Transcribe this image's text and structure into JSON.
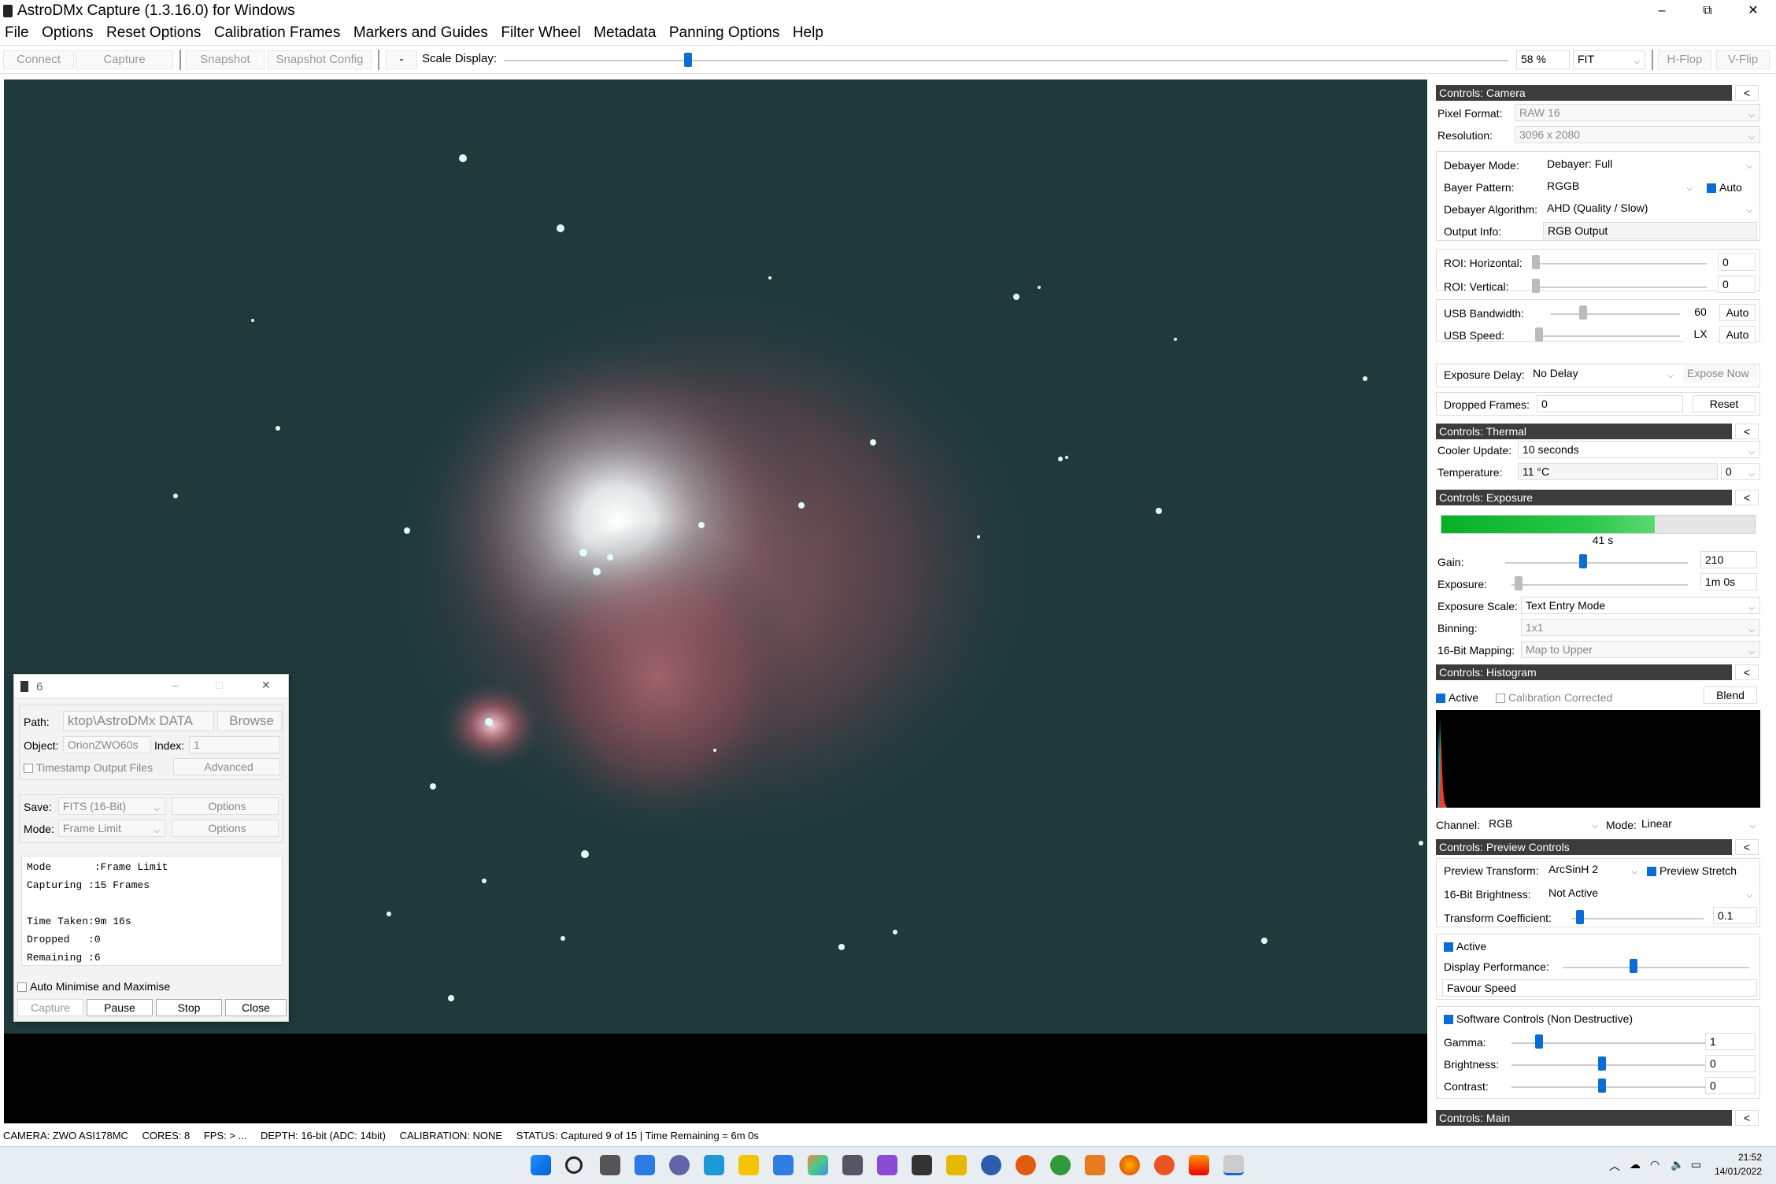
{
  "window": {
    "title": "AstroDMx Capture (1.3.16.0) for Windows",
    "minimize": "–",
    "restore": "⧉",
    "close": "✕"
  },
  "menu": [
    "File",
    "Options",
    "Reset Options",
    "Calibration Frames",
    "Markers and Guides",
    "Filter Wheel",
    "Metadata",
    "Panning Options",
    "Help"
  ],
  "toolbar": {
    "connect": "Connect",
    "capture": "Capture",
    "snapshot": "Snapshot",
    "snapshot_config": "Snapshot Config",
    "minus": "-",
    "scale_label": "Scale Display:",
    "scale_value": "58 %",
    "scale_percent": 58,
    "fit": "FIT",
    "hflip": "H-Flop",
    "vflip": "V-Flip"
  },
  "camera": {
    "header": "Controls: Camera",
    "collapse": "<",
    "pixel_format_label": "Pixel Format:",
    "pixel_format": "RAW 16",
    "resolution_label": "Resolution:",
    "resolution": "3096 x 2080",
    "debayer_mode_label": "Debayer Mode:",
    "debayer_mode": "Debayer: Full",
    "bayer_label": "Bayer Pattern:",
    "bayer": "RGGB",
    "auto": "Auto",
    "algo_label": "Debayer Algorithm:",
    "algo": "AHD (Quality / Slow)",
    "output_label": "Output Info:",
    "output": "RGB Output",
    "roi_h_label": "ROI: Horizontal:",
    "roi_h": "0",
    "roi_v_label": "ROI: Vertical:",
    "roi_v": "0",
    "usb_bw_label": "USB Bandwidth:",
    "usb_bw": "60",
    "usb_speed_label": "USB Speed:",
    "usb_speed": "LX",
    "exp_delay_label": "Exposure Delay:",
    "exp_delay": "No Delay",
    "expose_now": "Expose Now",
    "dropped_label": "Dropped Frames:",
    "dropped": "0",
    "reset": "Reset"
  },
  "thermal": {
    "header": "Controls: Thermal",
    "collapse": "<",
    "cooler_label": "Cooler Update:",
    "cooler": "10 seconds",
    "temp_label": "Temperature:",
    "temp": "11 °C",
    "temp_set": "0"
  },
  "exposure": {
    "header": "Controls: Exposure",
    "collapse": "<",
    "progress_text": "41 s",
    "progress_fraction": 0.68,
    "gain_label": "Gain:",
    "gain": "210",
    "exposure_label": "Exposure:",
    "exposure": "1m 0s",
    "scale_label": "Exposure Scale:",
    "scale": "Text Entry Mode",
    "binning_label": "Binning:",
    "binning": "1x1",
    "mapping_label": "16-Bit Mapping:",
    "mapping": "Map to Upper"
  },
  "histogram": {
    "header": "Controls: Histogram",
    "collapse": "<",
    "active": "Active",
    "calib": "Calibration Corrected",
    "blend": "Blend",
    "channel_label": "Channel:",
    "channel": "RGB",
    "mode_label": "Mode:",
    "mode": "Linear"
  },
  "preview": {
    "header": "Controls: Preview Controls",
    "collapse": "<",
    "transform_label": "Preview Transform:",
    "transform": "ArcSinH 2",
    "stretch": "Preview Stretch",
    "brightness16_label": "16-Bit Brightness:",
    "brightness16": "Not Active",
    "coef_label": "Transform Coefficient:",
    "coef": "0.1",
    "active": "Active",
    "perf_label": "Display Performance:",
    "perf": "Favour Speed",
    "software": "Software Controls (Non Destructive)",
    "gamma_label": "Gamma:",
    "gamma": "1",
    "bright_label": "Brightness:",
    "bright": "0",
    "contrast_label": "Contrast:",
    "contrast": "0"
  },
  "main": {
    "header": "Controls: Main",
    "collapse": "<"
  },
  "status": {
    "camera": "CAMERA: ZWO ASI178MC",
    "cores": "CORES: 8",
    "fps": "FPS: > ...",
    "depth": "DEPTH: 16-bit (ADC: 14bit)",
    "calibration": "CALIBRATION: NONE",
    "status": "STATUS: Captured 9 of 15 | Time Remaining = 6m 0s"
  },
  "capture_window": {
    "title": "6",
    "path_label": "Path:",
    "path": "ktop\\AstroDMx DATA",
    "browse": "Browse",
    "object_label": "Object:",
    "object": "OrionZWO60s",
    "index_label": "Index:",
    "index": "1",
    "timestamp": "Timestamp Output Files",
    "advanced": "Advanced",
    "save_label": "Save:",
    "save": "FITS (16-Bit)",
    "options": "Options",
    "mode_label": "Mode:",
    "mode": "Frame Limit",
    "log": [
      "Mode       :Frame Limit",
      "Capturing :15 Frames",
      "",
      "Time Taken:9m 16s",
      "Dropped   :0",
      "Remaining :6"
    ],
    "auto_min": "Auto Minimise and Maximise",
    "capture": "Capture",
    "pause": "Pause",
    "stop": "Stop",
    "close": "Close"
  },
  "tray": {
    "time": "21:52",
    "date": "14/01/2022"
  }
}
